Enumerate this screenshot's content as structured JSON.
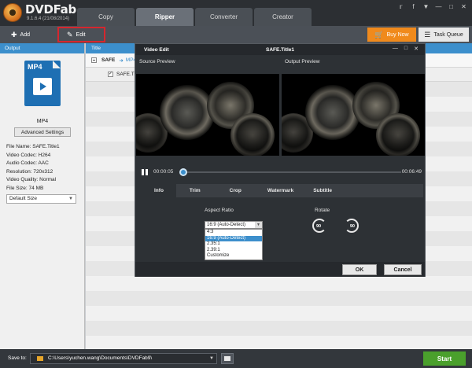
{
  "app": {
    "name": "DVDFab",
    "version": "9.1.6.4 (21/08/2014)"
  },
  "tabs": [
    "Copy",
    "Ripper",
    "Converter",
    "Creator"
  ],
  "active_tab": "Ripper",
  "window_icons": [
    "twitter-icon",
    "facebook-icon",
    "options-icon",
    "minimize-icon",
    "maximize-icon",
    "close-icon"
  ],
  "toolbar": {
    "add_label": "Add",
    "edit_label": "Edit",
    "buy_label": "Buy Now",
    "task_queue_label": "Task Queue"
  },
  "left_panel": {
    "header": "Output",
    "format_badge": "MP4",
    "format_label": "MP4",
    "advanced_button": "Advanced Settings",
    "props": [
      "File Name: SAFE.Title1",
      "Video Codec: H264",
      "Audio Codec: AAC",
      "Resolution: 720x312",
      "Video Quality: Normal",
      "File Size: 74 MB"
    ],
    "size_select": "Default Size"
  },
  "main": {
    "header": "Title",
    "row1_title": "SAFE",
    "row1_format": "MP4",
    "row2_title": "SAFE.Title1"
  },
  "dialog": {
    "title_left": "Video Edit",
    "title_center": "SAFE.Title1",
    "source_label": "Source Preview",
    "output_label": "Output Preview",
    "time_current": "00:00:05",
    "time_end": "00:06:49",
    "progress": 0.012,
    "tabs": [
      "Info",
      "Trim",
      "Crop",
      "Watermark",
      "Subtitle"
    ],
    "active_tab": "Info",
    "aspect_label": "Aspect Ratio",
    "rotate_label": "Rotate",
    "aspect_selected": "16:9 (Auto-Detect)",
    "aspect_options": [
      "4:3",
      "16:9 (Auto-Detect)",
      "2.35:1",
      "2.39:1",
      "Customize"
    ],
    "rotate_left": "90",
    "rotate_right": "90",
    "ok_label": "OK",
    "cancel_label": "Cancel"
  },
  "bottom": {
    "save_label": "Save to:",
    "path": "C:\\Users\\yuchen.wang\\Documents\\DVDFab9\\",
    "start_label": "Start"
  },
  "colors": {
    "accent_blue": "#3c8fcc",
    "buy_orange": "#f08a1c",
    "start_green": "#4aa02c",
    "highlight_red": "#d6262e"
  }
}
